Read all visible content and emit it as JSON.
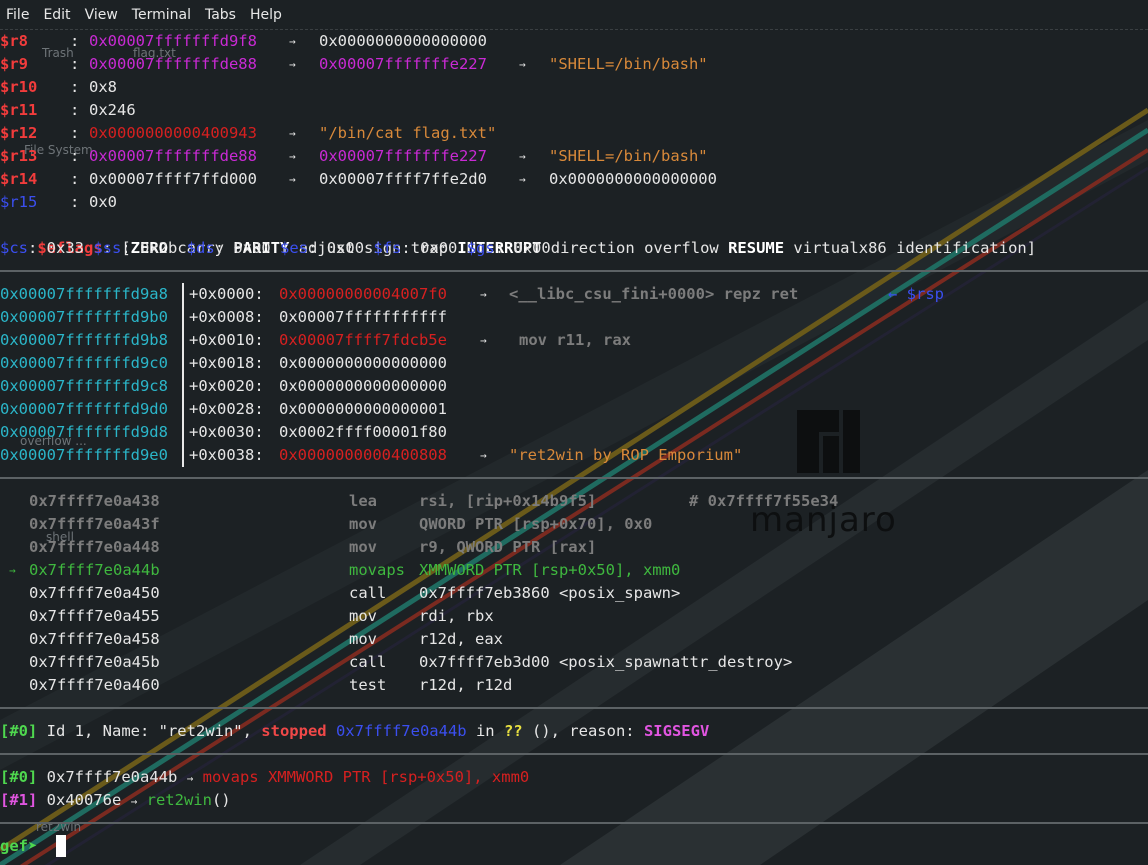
{
  "menu": [
    "File",
    "Edit",
    "View",
    "Terminal",
    "Tabs",
    "Help"
  ],
  "desktop": {
    "trash": "Trash",
    "flag": "flag.txt",
    "filesystem": "File System",
    "overflow": "overflow ...",
    "shell": "shell",
    "ret2win": "ret2win",
    "logo_text": "manjaro"
  },
  "registers": {
    "r8": {
      "name": "$r8",
      "val": "0x00007fffffffd9f8",
      "arrow": "→",
      "target": "0x0000000000000000"
    },
    "r9": {
      "name": "$r9",
      "val": "0x00007fffffffde88",
      "arrow": "→",
      "target": "0x00007fffffffe227",
      "arrow2": "→",
      "str": "\"SHELL=/bin/bash\""
    },
    "r10": {
      "name": "$r10",
      "val": "0x8"
    },
    "r11": {
      "name": "$r11",
      "val": "0x246"
    },
    "r12": {
      "name": "$r12",
      "val": "0x0000000000400943",
      "arrow": "→",
      "str": "\"/bin/cat flag.txt\""
    },
    "r13": {
      "name": "$r13",
      "val": "0x00007fffffffde88",
      "arrow": "→",
      "target": "0x00007fffffffe227",
      "arrow2": "→",
      "str": "\"SHELL=/bin/bash\""
    },
    "r14": {
      "name": "$r14",
      "val": "0x00007ffff7ffd000",
      "arrow": "→",
      "target": "0x00007ffff7ffe2d0",
      "arrow2": "→",
      "target2": "0x0000000000000000"
    },
    "r15": {
      "name": "$r15",
      "val": "0x0"
    },
    "eflags": {
      "name": "$eflags",
      "open": "[",
      "zero": "ZERO",
      "carry": "carry",
      "parity": "PARITY",
      "adjust": "adjust",
      "sign": "sign",
      "trap": "trap",
      "interrupt": "INTERRUPT",
      "direction": "direction",
      "overflow": "overflow",
      "resume": "RESUME",
      "v86": "virtualx86",
      "ident": "identification]"
    },
    "segs": [
      {
        "name": "$cs",
        "val": "0x33"
      },
      {
        "name": "$ss",
        "val": "0x2b"
      },
      {
        "name": "$ds",
        "val": "0x00"
      },
      {
        "name": "$es",
        "val": "0x00"
      },
      {
        "name": "$fs",
        "val": "0x00"
      },
      {
        "name": "$gs",
        "val": "0x00"
      }
    ]
  },
  "stack": [
    {
      "addr": "0x00007fffffffd9a8",
      "off": "+0x0000:",
      "val": "0x00000000004007f0",
      "arrow": "→",
      "extra": "<__libc_csu_fini+0000> repz ret",
      "tag": "← $rsp"
    },
    {
      "addr": "0x00007fffffffd9b0",
      "off": "+0x0008:",
      "val": "0x00007fffffffffff"
    },
    {
      "addr": "0x00007fffffffd9b8",
      "off": "+0x0010:",
      "val": "0x00007ffff7fdcb5e",
      "arrow": "→",
      "extra": "mov r11, rax"
    },
    {
      "addr": "0x00007fffffffd9c0",
      "off": "+0x0018:",
      "val": "0x0000000000000000"
    },
    {
      "addr": "0x00007fffffffd9c8",
      "off": "+0x0020:",
      "val": "0x0000000000000000"
    },
    {
      "addr": "0x00007fffffffd9d0",
      "off": "+0x0028:",
      "val": "0x0000000000000001"
    },
    {
      "addr": "0x00007fffffffd9d8",
      "off": "+0x0030:",
      "val": "0x0002ffff00001f80"
    },
    {
      "addr": "0x00007fffffffd9e0",
      "off": "+0x0038:",
      "val": "0x0000000000400808",
      "arrow": "→",
      "extra": "\"ret2win by ROP Emporium\""
    }
  ],
  "code": [
    {
      "addr": "0x7ffff7e0a438",
      "op": "lea",
      "args": "rsi, [rip+0x14b9f5]",
      "comment": "# 0x7ffff7f55e34"
    },
    {
      "addr": "0x7ffff7e0a43f",
      "op": "mov",
      "args": "QWORD PTR [rsp+0x70], 0x0"
    },
    {
      "addr": "0x7ffff7e0a448",
      "op": "mov",
      "args": "r9, QWORD PTR [rax]"
    },
    {
      "addr": "0x7ffff7e0a44b",
      "op": "movaps",
      "args": "XMMWORD PTR [rsp+0x50], xmm0",
      "current": "→"
    },
    {
      "addr": "0x7ffff7e0a450",
      "op": "call",
      "args": "0x7ffff7eb3860 <posix_spawn>"
    },
    {
      "addr": "0x7ffff7e0a455",
      "op": "mov",
      "args": "rdi, rbx"
    },
    {
      "addr": "0x7ffff7e0a458",
      "op": "mov",
      "args": "r12d, eax"
    },
    {
      "addr": "0x7ffff7e0a45b",
      "op": "call",
      "args": "0x7ffff7eb3d00 <posix_spawnattr_destroy>"
    },
    {
      "addr": "0x7ffff7e0a460",
      "op": "test",
      "args": "r12d, r12d"
    }
  ],
  "thread": {
    "idx": "[#0]",
    "text": " Id 1, Name: \"ret2win\", ",
    "stopped": "stopped",
    "addr": "0x7ffff7e0a44b",
    "in": " in ",
    "qq": "??",
    "rest": " (), reason: ",
    "reason": "SIGSEGV"
  },
  "trace": [
    {
      "idx": "[#0]",
      "addr": "0x7ffff7e0a44b",
      "arrow": "→",
      "insn": "movaps XMMWORD PTR [rsp+0x50], xmm0"
    },
    {
      "idx": "[#1]",
      "addr": "0x40076e",
      "arrow": "→",
      "fn": "ret2win",
      "paren": "()"
    }
  ],
  "prompt": "gef➤",
  "colors": {
    "register": "#f23c3c",
    "pointer": "#c92ad4",
    "string": "#d8893a",
    "background": "#1b2022"
  }
}
